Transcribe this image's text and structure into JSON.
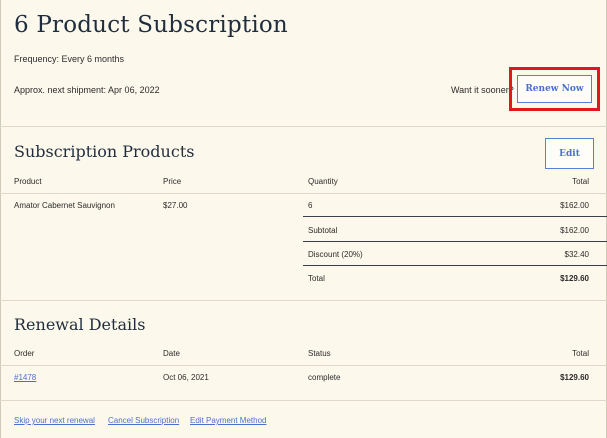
{
  "header": {
    "title": "6 Product Subscription",
    "frequency": "Frequency: Every 6 months",
    "next_shipment": "Approx. next shipment: Apr 06, 2022",
    "want_sooner": "Want it sooner?",
    "renew_label": "Renew Now"
  },
  "products": {
    "title": "Subscription Products",
    "edit_label": "Edit",
    "columns": [
      "Product",
      "Price",
      "Quantity",
      "Total"
    ],
    "rows": [
      {
        "product": "Amator Cabernet Sauvignon",
        "price": "$27.00",
        "quantity": "6",
        "total": "$162.00"
      }
    ],
    "summary": [
      {
        "label": "Subtotal",
        "value": "$162.00"
      },
      {
        "label": "Discount (20%)",
        "value": "$32.40"
      },
      {
        "label": "Total",
        "value": "$129.60"
      }
    ]
  },
  "renewal": {
    "title": "Renewal Details",
    "columns": [
      "Order",
      "Date",
      "Status",
      "Total"
    ],
    "rows": [
      {
        "order": "#1478",
        "date": "Oct 06, 2021",
        "status": "complete",
        "total": "$129.60"
      }
    ]
  },
  "footer": {
    "skip": "Skip your next renewal",
    "cancel": "Cancel Subscription",
    "edit_payment": "Edit Payment Method"
  },
  "colors": {
    "background": "#fdf8ec",
    "accent": "#4a6fce",
    "highlight": "#e3161d"
  }
}
